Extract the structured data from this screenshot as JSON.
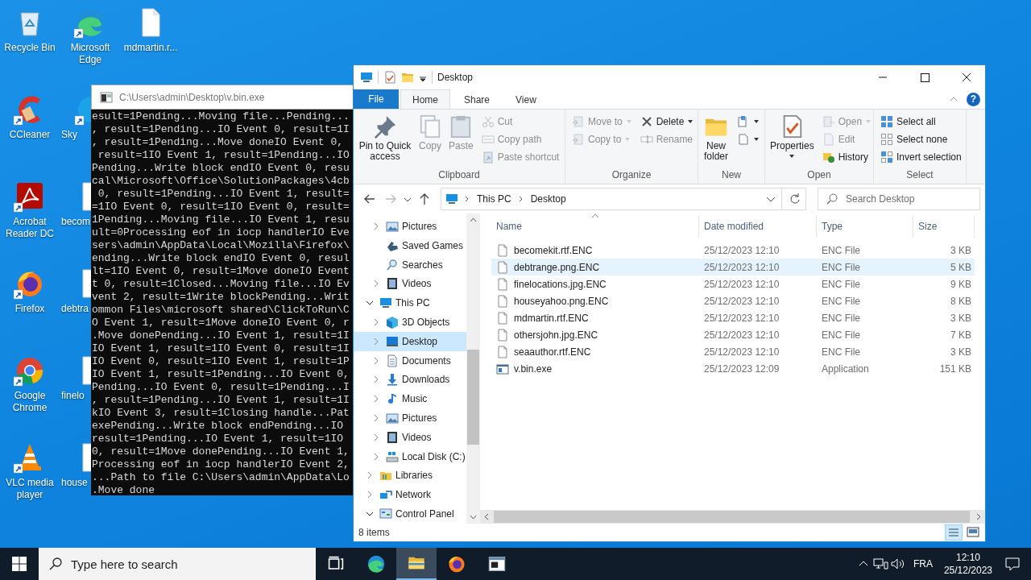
{
  "desktop_icons": [
    {
      "label": "Recycle Bin",
      "shortcut": false,
      "covered": false
    },
    {
      "label": "CCleaner",
      "shortcut": true,
      "covered": false
    },
    {
      "label": "Acrobat Reader DC",
      "shortcut": true,
      "covered": false
    },
    {
      "label": "Firefox",
      "shortcut": true,
      "covered": false
    },
    {
      "label": "Google Chrome",
      "shortcut": true,
      "covered": false
    },
    {
      "label": "VLC media player",
      "shortcut": true,
      "covered": false
    },
    {
      "label": "Microsoft Edge",
      "shortcut": true,
      "covered": false
    },
    {
      "label": "Sky",
      "shortcut": true,
      "covered": true
    },
    {
      "label": "becom",
      "shortcut": false,
      "covered": true
    },
    {
      "label": "debtra",
      "shortcut": false,
      "covered": true
    },
    {
      "label": "finelo",
      "shortcut": false,
      "covered": true
    },
    {
      "label": "house",
      "shortcut": false,
      "covered": true
    },
    {
      "label": "mdmartin.r...",
      "shortcut": false,
      "covered": false
    }
  ],
  "console": {
    "title": "C:\\Users\\admin\\Desktop\\v.bin.exe",
    "lines": [
      "esult=1Pending...Moving file...Pending...",
      ", result=1Pending...IO Event 0, result=1I",
      ", result=1Pending...Move doneIO Event 0,",
      " result=1IO Event 1, result=1Pending...IO",
      "Pending...Write block endIO Event 0, resu",
      "cal\\Microsoft\\Office\\SolutionPackages\\4cb",
      " 0, result=1Pending...IO Event 1, result=",
      "=1IO Event 0, result=1IO Event 0, result=",
      "1Pending...Moving file...IO Event 1, resu",
      "ult=0Processing eof in iocp handlerIO Eve",
      "sers\\admin\\AppData\\Local\\Mozilla\\Firefox\\",
      "ending...Write block endIO Event 0, resul",
      "lt=1IO Event 0, result=1Move doneIO Event",
      "t 0, result=1Closed...Moving file...IO Ev",
      "vent 2, result=1Write blockPending...Writ",
      "ommon Files\\microsoft shared\\ClickToRun\\C",
      "O Event 1, result=1Move doneIO Event 0, r",
      ".Move donePending...IO Event 1, result=1I",
      "IO Event 1, result=1IO Event 0, result=1I",
      "IO Event 0, result=1IO Event 1, result=1P",
      "IO Event 1, result=1Pending...IO Event 0,",
      "Pending...IO Event 0, result=1Pending...I",
      ", result=1Pending...IO Event 1, result=1I",
      "kIO Event 3, result=1Closing handle...Pat",
      "exePending...Write block endPending...IO",
      "result=1Pending...IO Event 1, result=1IO",
      "0, result=1Move donePending...IO Event 1,",
      "Processing eof in iocp handlerIO Event 2,",
      "...Path to file C:\\Users\\admin\\AppData\\Lo",
      ".Move done"
    ]
  },
  "explorer": {
    "title": "Desktop",
    "file_tab": "File",
    "tabs": [
      {
        "label": "Home",
        "selected": true
      },
      {
        "label": "Share",
        "selected": false
      },
      {
        "label": "View",
        "selected": false
      }
    ],
    "help": "?",
    "ribbon_groups": [
      {
        "label": "Clipboard",
        "items": [
          {
            "kind": "large",
            "label": "Pin to Quick access",
            "disabled": false,
            "dropdown": false
          },
          {
            "kind": "large",
            "label": "Copy",
            "disabled": true,
            "dropdown": false
          },
          {
            "kind": "large",
            "label": "Paste",
            "disabled": true,
            "dropdown": false
          },
          {
            "kind": "stack",
            "items": [
              {
                "label": "Cut",
                "disabled": true,
                "dropdown": false
              },
              {
                "label": "Copy path",
                "disabled": true,
                "dropdown": false
              },
              {
                "label": "Paste shortcut",
                "disabled": true,
                "dropdown": false
              }
            ]
          }
        ]
      },
      {
        "label": "Organize",
        "items": [
          {
            "kind": "stack",
            "items": [
              {
                "label": "Move to",
                "disabled": true,
                "dropdown": true
              },
              {
                "label": "Copy to",
                "disabled": true,
                "dropdown": true
              }
            ]
          },
          {
            "kind": "stack",
            "items": [
              {
                "label": "Delete",
                "disabled": false,
                "dropdown": true
              },
              {
                "label": "Rename",
                "disabled": true,
                "dropdown": false
              }
            ]
          }
        ]
      },
      {
        "label": "New",
        "items": [
          {
            "kind": "large",
            "label": "New folder",
            "disabled": false,
            "dropdown": false
          },
          {
            "kind": "stack",
            "items": [
              {
                "disabled": false,
                "dropdown": true
              },
              {
                "disabled": false,
                "dropdown": true
              }
            ]
          }
        ]
      },
      {
        "label": "Open",
        "items": [
          {
            "kind": "large",
            "label": "Properties",
            "disabled": false,
            "dropdown": true
          },
          {
            "kind": "stack",
            "items": [
              {
                "label": "Open",
                "disabled": true,
                "dropdown": true
              },
              {
                "label": "Edit",
                "disabled": true,
                "dropdown": false
              },
              {
                "label": "History",
                "disabled": false,
                "dropdown": false
              }
            ]
          }
        ]
      },
      {
        "label": "Select",
        "items": [
          {
            "kind": "stack",
            "items": [
              {
                "label": "Select all",
                "disabled": false,
                "dropdown": false
              },
              {
                "label": "Select none",
                "disabled": false,
                "dropdown": false
              },
              {
                "label": "Invert selection",
                "disabled": false,
                "dropdown": false
              }
            ]
          }
        ]
      }
    ],
    "address": [
      "This PC",
      "Desktop"
    ],
    "search_placeholder": "Search Desktop",
    "nav_tree": [
      {
        "children": [
          {
            "label": "Pictures",
            "expanded": false,
            "selected": false
          },
          {
            "label": "Saved Games",
            "selected": false
          },
          {
            "label": "Searches",
            "selected": false
          },
          {
            "label": "Videos",
            "expanded": false,
            "selected": false
          }
        ]
      },
      {
        "label": "This PC",
        "expanded": true,
        "selected": false,
        "children": [
          {
            "label": "3D Objects",
            "expanded": false,
            "selected": false
          },
          {
            "label": "Desktop",
            "expanded": false,
            "selected": true
          },
          {
            "label": "Documents",
            "expanded": false,
            "selected": false
          },
          {
            "label": "Downloads",
            "expanded": false,
            "selected": false
          },
          {
            "label": "Music",
            "expanded": false,
            "selected": false
          },
          {
            "label": "Pictures",
            "expanded": false,
            "selected": false
          },
          {
            "label": "Videos",
            "expanded": false,
            "selected": false
          },
          {
            "label": "Local Disk (C:)",
            "expanded": false,
            "selected": false
          }
        ]
      },
      {
        "label": "Libraries",
        "expanded": false,
        "selected": false
      },
      {
        "label": "Network",
        "expanded": false,
        "selected": false
      },
      {
        "label": "Control Panel",
        "expanded": true,
        "selected": false
      }
    ],
    "columns": [
      {
        "label": "Name",
        "sorted": true
      },
      {
        "label": "Date modified",
        "sorted": false
      },
      {
        "label": "Type",
        "sorted": false
      },
      {
        "label": "Size",
        "sorted": false
      }
    ],
    "files": [
      {
        "name": "becomekit.rtf.ENC",
        "date": "25/12/2023 12:10",
        "type": "ENC File",
        "size": "3 KB",
        "kind": "document",
        "selected": false
      },
      {
        "name": "debtrange.png.ENC",
        "date": "25/12/2023 12:10",
        "type": "ENC File",
        "size": "5 KB",
        "kind": "document",
        "selected": true
      },
      {
        "name": "finelocations.jpg.ENC",
        "date": "25/12/2023 12:10",
        "type": "ENC File",
        "size": "9 KB",
        "kind": "document",
        "selected": false
      },
      {
        "name": "houseyahoo.png.ENC",
        "date": "25/12/2023 12:10",
        "type": "ENC File",
        "size": "8 KB",
        "kind": "document",
        "selected": false
      },
      {
        "name": "mdmartin.rtf.ENC",
        "date": "25/12/2023 12:10",
        "type": "ENC File",
        "size": "3 KB",
        "kind": "document",
        "selected": false
      },
      {
        "name": "othersjohn.jpg.ENC",
        "date": "25/12/2023 12:10",
        "type": "ENC File",
        "size": "7 KB",
        "kind": "document",
        "selected": false
      },
      {
        "name": "seaauthor.rtf.ENC",
        "date": "25/12/2023 12:10",
        "type": "ENC File",
        "size": "3 KB",
        "kind": "document",
        "selected": false
      },
      {
        "name": "v.bin.exe",
        "date": "25/12/2023 12:09",
        "type": "Application",
        "size": "151 KB",
        "kind": "application",
        "selected": false
      }
    ],
    "status": "8 items"
  },
  "taskbar": {
    "search_placeholder": "Type here to search",
    "apps": [
      {
        "active": false
      },
      {
        "active": false
      },
      {
        "active": true
      },
      {
        "active": false
      },
      {
        "active": false
      }
    ],
    "language": "FRA",
    "time": "12:10",
    "date": "25/12/2023"
  }
}
